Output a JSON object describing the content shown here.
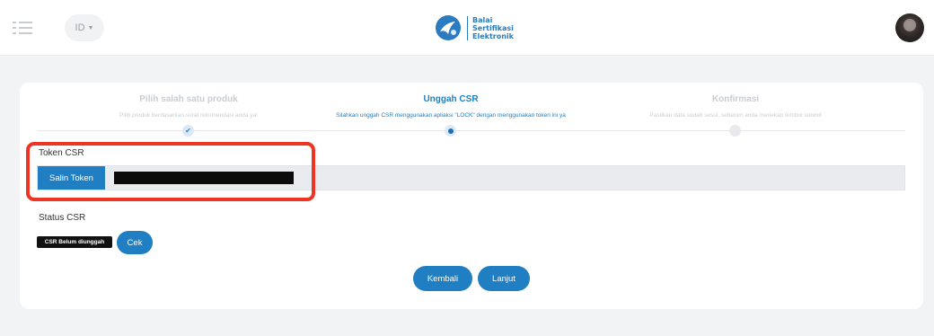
{
  "header": {
    "lang_label": "ID",
    "brand_lines": [
      "Balai",
      "Sertifikasi",
      "Elektronik"
    ]
  },
  "steps": [
    {
      "title": "Pilih salah satu produk",
      "desc": "Pilih produk berdasarkan surat rekomendasi anda ya!",
      "state": "done"
    },
    {
      "title": "Unggah CSR",
      "desc": "Silahkan unggah CSR menggunakan apliaksi \"LOCK\" dengan menggunakan token ini ya",
      "state": "current"
    },
    {
      "title": "Konfirmasi",
      "desc": "Pastikan data sudah sesui, sebelum anda menekan tombol submit",
      "state": "pending"
    }
  ],
  "token": {
    "label": "Token CSR",
    "copy_label": "Salin Token",
    "value": ""
  },
  "status": {
    "label": "Status CSR",
    "badge": "CSR Belum diunggah",
    "check_label": "Cek"
  },
  "actions": {
    "back_label": "Kembali",
    "next_label": "Lanjut"
  },
  "colors": {
    "primary": "#1f7fc2",
    "highlight": "#ee3524",
    "badge_bg": "#111111"
  },
  "icons": {
    "menu": "menu-icon",
    "done_step": "check-icon",
    "caret": "chevron-down-icon"
  }
}
